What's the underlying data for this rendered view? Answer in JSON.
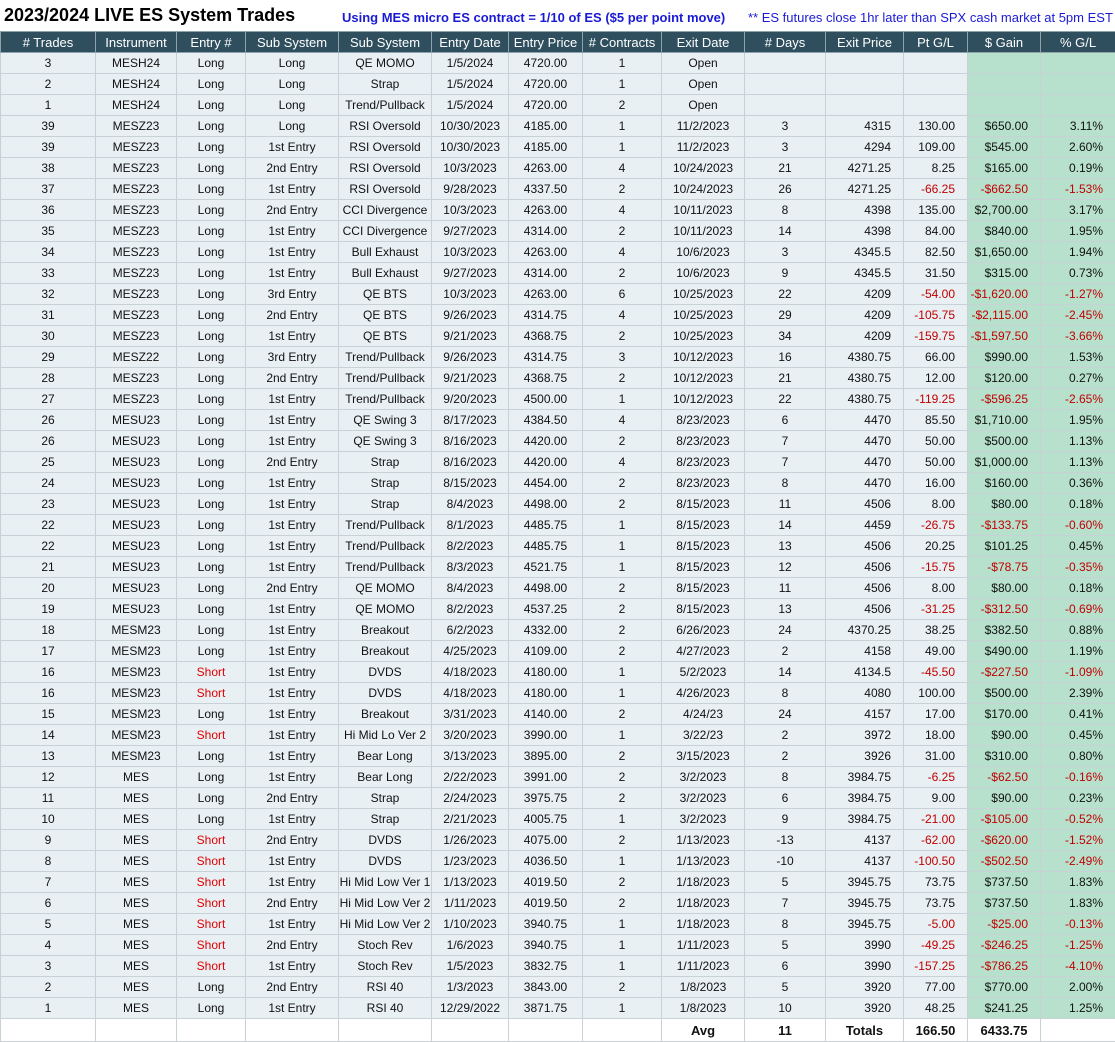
{
  "header": {
    "title": "2023/2024 LIVE ES System Trades",
    "note_contract": "Using MES micro ES contract = 1/10 of ES ($5 per point move)",
    "note_close": "** ES futures close 1hr later than SPX cash market at 5pm EST"
  },
  "columns": [
    "# Trades",
    "Instrument",
    "Entry #",
    "Sub System",
    "Sub System",
    "Entry Date",
    "Entry Price",
    "# Contracts",
    "Exit Date",
    "# Days",
    "Exit Price",
    "Pt G/L",
    "$ Gain",
    "% G/L"
  ],
  "rows": [
    [
      "3",
      "MESH24",
      "Long",
      "Long",
      "QE MOMO",
      "1/5/2024",
      "4720.00",
      "1",
      "Open",
      "",
      "",
      "",
      "",
      ""
    ],
    [
      "2",
      "MESH24",
      "Long",
      "Long",
      "Strap",
      "1/5/2024",
      "4720.00",
      "1",
      "Open",
      "",
      "",
      "",
      "",
      ""
    ],
    [
      "1",
      "MESH24",
      "Long",
      "Long",
      "Trend/Pullback",
      "1/5/2024",
      "4720.00",
      "2",
      "Open",
      "",
      "",
      "",
      "",
      ""
    ],
    [
      "39",
      "MESZ23",
      "Long",
      "Long",
      "RSI Oversold",
      "10/30/2023",
      "4185.00",
      "1",
      "11/2/2023",
      "3",
      "4315",
      "130.00",
      "$650.00",
      "3.11%"
    ],
    [
      "39",
      "MESZ23",
      "Long",
      "1st Entry",
      "RSI Oversold",
      "10/30/2023",
      "4185.00",
      "1",
      "11/2/2023",
      "3",
      "4294",
      "109.00",
      "$545.00",
      "2.60%"
    ],
    [
      "38",
      "MESZ23",
      "Long",
      "2nd Entry",
      "RSI Oversold",
      "10/3/2023",
      "4263.00",
      "4",
      "10/24/2023",
      "21",
      "4271.25",
      "8.25",
      "$165.00",
      "0.19%"
    ],
    [
      "37",
      "MESZ23",
      "Long",
      "1st Entry",
      "RSI Oversold",
      "9/28/2023",
      "4337.50",
      "2",
      "10/24/2023",
      "26",
      "4271.25",
      "-66.25",
      "-$662.50",
      "-1.53%"
    ],
    [
      "36",
      "MESZ23",
      "Long",
      "2nd Entry",
      "CCI Divergence",
      "10/3/2023",
      "4263.00",
      "4",
      "10/11/2023",
      "8",
      "4398",
      "135.00",
      "$2,700.00",
      "3.17%"
    ],
    [
      "35",
      "MESZ23",
      "Long",
      "1st Entry",
      "CCI Divergence",
      "9/27/2023",
      "4314.00",
      "2",
      "10/11/2023",
      "14",
      "4398",
      "84.00",
      "$840.00",
      "1.95%"
    ],
    [
      "34",
      "MESZ23",
      "Long",
      "1st Entry",
      "Bull Exhaust",
      "10/3/2023",
      "4263.00",
      "4",
      "10/6/2023",
      "3",
      "4345.5",
      "82.50",
      "$1,650.00",
      "1.94%"
    ],
    [
      "33",
      "MESZ23",
      "Long",
      "1st Entry",
      "Bull Exhaust",
      "9/27/2023",
      "4314.00",
      "2",
      "10/6/2023",
      "9",
      "4345.5",
      "31.50",
      "$315.00",
      "0.73%"
    ],
    [
      "32",
      "MESZ23",
      "Long",
      "3rd Entry",
      "QE BTS",
      "10/3/2023",
      "4263.00",
      "6",
      "10/25/2023",
      "22",
      "4209",
      "-54.00",
      "-$1,620.00",
      "-1.27%"
    ],
    [
      "31",
      "MESZ23",
      "Long",
      "2nd Entry",
      "QE BTS",
      "9/26/2023",
      "4314.75",
      "4",
      "10/25/2023",
      "29",
      "4209",
      "-105.75",
      "-$2,115.00",
      "-2.45%"
    ],
    [
      "30",
      "MESZ23",
      "Long",
      "1st Entry",
      "QE BTS",
      "9/21/2023",
      "4368.75",
      "2",
      "10/25/2023",
      "34",
      "4209",
      "-159.75",
      "-$1,597.50",
      "-3.66%"
    ],
    [
      "29",
      "MESZ22",
      "Long",
      "3rd Entry",
      "Trend/Pullback",
      "9/26/2023",
      "4314.75",
      "3",
      "10/12/2023",
      "16",
      "4380.75",
      "66.00",
      "$990.00",
      "1.53%"
    ],
    [
      "28",
      "MESZ23",
      "Long",
      "2nd Entry",
      "Trend/Pullback",
      "9/21/2023",
      "4368.75",
      "2",
      "10/12/2023",
      "21",
      "4380.75",
      "12.00",
      "$120.00",
      "0.27%"
    ],
    [
      "27",
      "MESZ23",
      "Long",
      "1st Entry",
      "Trend/Pullback",
      "9/20/2023",
      "4500.00",
      "1",
      "10/12/2023",
      "22",
      "4380.75",
      "-119.25",
      "-$596.25",
      "-2.65%"
    ],
    [
      "26",
      "MESU23",
      "Long",
      "1st Entry",
      "QE Swing 3",
      "8/17/2023",
      "4384.50",
      "4",
      "8/23/2023",
      "6",
      "4470",
      "85.50",
      "$1,710.00",
      "1.95%"
    ],
    [
      "26",
      "MESU23",
      "Long",
      "1st Entry",
      "QE Swing 3",
      "8/16/2023",
      "4420.00",
      "2",
      "8/23/2023",
      "7",
      "4470",
      "50.00",
      "$500.00",
      "1.13%"
    ],
    [
      "25",
      "MESU23",
      "Long",
      "2nd Entry",
      "Strap",
      "8/16/2023",
      "4420.00",
      "4",
      "8/23/2023",
      "7",
      "4470",
      "50.00",
      "$1,000.00",
      "1.13%"
    ],
    [
      "24",
      "MESU23",
      "Long",
      "1st Entry",
      "Strap",
      "8/15/2023",
      "4454.00",
      "2",
      "8/23/2023",
      "8",
      "4470",
      "16.00",
      "$160.00",
      "0.36%"
    ],
    [
      "23",
      "MESU23",
      "Long",
      "1st Entry",
      "Strap",
      "8/4/2023",
      "4498.00",
      "2",
      "8/15/2023",
      "11",
      "4506",
      "8.00",
      "$80.00",
      "0.18%"
    ],
    [
      "22",
      "MESU23",
      "Long",
      "1st Entry",
      "Trend/Pullback",
      "8/1/2023",
      "4485.75",
      "1",
      "8/15/2023",
      "14",
      "4459",
      "-26.75",
      "-$133.75",
      "-0.60%"
    ],
    [
      "22",
      "MESU23",
      "Long",
      "1st Entry",
      "Trend/Pullback",
      "8/2/2023",
      "4485.75",
      "1",
      "8/15/2023",
      "13",
      "4506",
      "20.25",
      "$101.25",
      "0.45%"
    ],
    [
      "21",
      "MESU23",
      "Long",
      "1st Entry",
      "Trend/Pullback",
      "8/3/2023",
      "4521.75",
      "1",
      "8/15/2023",
      "12",
      "4506",
      "-15.75",
      "-$78.75",
      "-0.35%"
    ],
    [
      "20",
      "MESU23",
      "Long",
      "2nd Entry",
      "QE MOMO",
      "8/4/2023",
      "4498.00",
      "2",
      "8/15/2023",
      "11",
      "4506",
      "8.00",
      "$80.00",
      "0.18%"
    ],
    [
      "19",
      "MESU23",
      "Long",
      "1st Entry",
      "QE MOMO",
      "8/2/2023",
      "4537.25",
      "2",
      "8/15/2023",
      "13",
      "4506",
      "-31.25",
      "-$312.50",
      "-0.69%"
    ],
    [
      "18",
      "MESM23",
      "Long",
      "1st Entry",
      "Breakout",
      "6/2/2023",
      "4332.00",
      "2",
      "6/26/2023",
      "24",
      "4370.25",
      "38.25",
      "$382.50",
      "0.88%"
    ],
    [
      "17",
      "MESM23",
      "Long",
      "1st Entry",
      "Breakout",
      "4/25/2023",
      "4109.00",
      "2",
      "4/27/2023",
      "2",
      "4158",
      "49.00",
      "$490.00",
      "1.19%"
    ],
    [
      "16",
      "MESM23",
      "Short",
      "1st Entry",
      "DVDS",
      "4/18/2023",
      "4180.00",
      "1",
      "5/2/2023",
      "14",
      "4134.5",
      "-45.50",
      "-$227.50",
      "-1.09%"
    ],
    [
      "16",
      "MESM23",
      "Short",
      "1st Entry",
      "DVDS",
      "4/18/2023",
      "4180.00",
      "1",
      "4/26/2023",
      "8",
      "4080",
      "100.00",
      "$500.00",
      "2.39%"
    ],
    [
      "15",
      "MESM23",
      "Long",
      "1st Entry",
      "Breakout",
      "3/31/2023",
      "4140.00",
      "2",
      "4/24/23",
      "24",
      "4157",
      "17.00",
      "$170.00",
      "0.41%"
    ],
    [
      "14",
      "MESM23",
      "Short",
      "1st Entry",
      "Hi Mid Lo Ver 2",
      "3/20/2023",
      "3990.00",
      "1",
      "3/22/23",
      "2",
      "3972",
      "18.00",
      "$90.00",
      "0.45%"
    ],
    [
      "13",
      "MESM23",
      "Long",
      "1st Entry",
      "Bear Long",
      "3/13/2023",
      "3895.00",
      "2",
      "3/15/2023",
      "2",
      "3926",
      "31.00",
      "$310.00",
      "0.80%"
    ],
    [
      "12",
      "MES",
      "Long",
      "1st Entry",
      "Bear Long",
      "2/22/2023",
      "3991.00",
      "2",
      "3/2/2023",
      "8",
      "3984.75",
      "-6.25",
      "-$62.50",
      "-0.16%"
    ],
    [
      "11",
      "MES",
      "Long",
      "2nd Entry",
      "Strap",
      "2/24/2023",
      "3975.75",
      "2",
      "3/2/2023",
      "6",
      "3984.75",
      "9.00",
      "$90.00",
      "0.23%"
    ],
    [
      "10",
      "MES",
      "Long",
      "1st Entry",
      "Strap",
      "2/21/2023",
      "4005.75",
      "1",
      "3/2/2023",
      "9",
      "3984.75",
      "-21.00",
      "-$105.00",
      "-0.52%"
    ],
    [
      "9",
      "MES",
      "Short",
      "2nd Entry",
      "DVDS",
      "1/26/2023",
      "4075.00",
      "2",
      "1/13/2023",
      "-13",
      "4137",
      "-62.00",
      "-$620.00",
      "-1.52%"
    ],
    [
      "8",
      "MES",
      "Short",
      "1st Entry",
      "DVDS",
      "1/23/2023",
      "4036.50",
      "1",
      "1/13/2023",
      "-10",
      "4137",
      "-100.50",
      "-$502.50",
      "-2.49%"
    ],
    [
      "7",
      "MES",
      "Short",
      "1st Entry",
      "Hi Mid Low Ver 1",
      "1/13/2023",
      "4019.50",
      "2",
      "1/18/2023",
      "5",
      "3945.75",
      "73.75",
      "$737.50",
      "1.83%"
    ],
    [
      "6",
      "MES",
      "Short",
      "2nd Entry",
      "Hi Mid Low Ver 2",
      "1/11/2023",
      "4019.50",
      "2",
      "1/18/2023",
      "7",
      "3945.75",
      "73.75",
      "$737.50",
      "1.83%"
    ],
    [
      "5",
      "MES",
      "Short",
      "1st Entry",
      "Hi Mid Low Ver 2",
      "1/10/2023",
      "3940.75",
      "1",
      "1/18/2023",
      "8",
      "3945.75",
      "-5.00",
      "-$25.00",
      "-0.13%"
    ],
    [
      "4",
      "MES",
      "Short",
      "2nd Entry",
      "Stoch Rev",
      "1/6/2023",
      "3940.75",
      "1",
      "1/11/2023",
      "5",
      "3990",
      "-49.25",
      "-$246.25",
      "-1.25%"
    ],
    [
      "3",
      "MES",
      "Short",
      "1st Entry",
      "Stoch Rev",
      "1/5/2023",
      "3832.75",
      "1",
      "1/11/2023",
      "6",
      "3990",
      "-157.25",
      "-$786.25",
      "-4.10%"
    ],
    [
      "2",
      "MES",
      "Long",
      "2nd Entry",
      "RSI 40",
      "1/3/2023",
      "3843.00",
      "2",
      "1/8/2023",
      "5",
      "3920",
      "77.00",
      "$770.00",
      "2.00%"
    ],
    [
      "1",
      "MES",
      "Long",
      "1st Entry",
      "RSI 40",
      "12/29/2022",
      "3871.75",
      "1",
      "1/8/2023",
      "10",
      "3920",
      "48.25",
      "$241.25",
      "1.25%"
    ]
  ],
  "footer": {
    "avg_label": "Avg",
    "avg_days": "11",
    "totals_label": "Totals",
    "total_pts": "166.50",
    "total_gain": "6433.75"
  },
  "colors": {
    "header_bg": "#2f4f5e",
    "row_bg": "#e8f0f4",
    "gain_bg": "#b7e1cd",
    "negative": "#c00000",
    "short": "#e00000",
    "note_blue": "#1a1ad6"
  }
}
